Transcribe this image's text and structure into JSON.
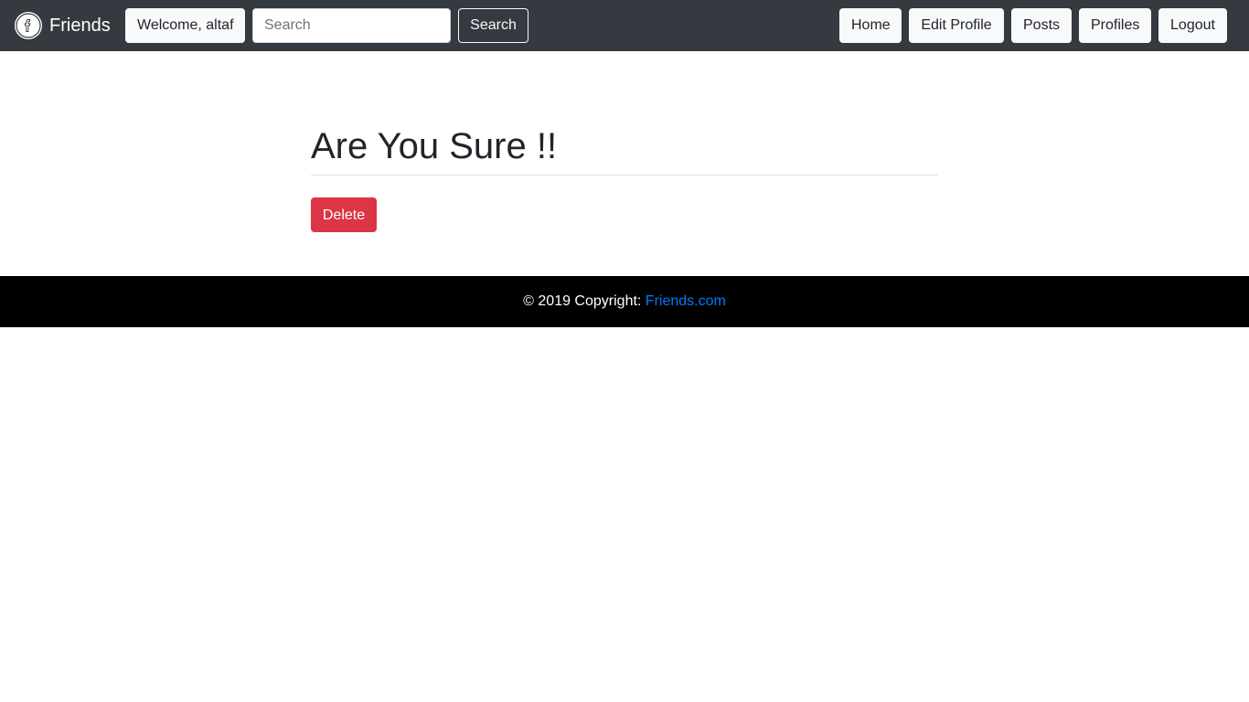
{
  "navbar": {
    "brand_label": "Friends",
    "logo_icon": "facebook-f-icon",
    "welcome_label": "Welcome, altaf",
    "search": {
      "placeholder": "Search",
      "value": "",
      "button_label": "Search"
    },
    "links": [
      {
        "label": "Home"
      },
      {
        "label": "Edit Profile"
      },
      {
        "label": "Posts"
      },
      {
        "label": "Profiles"
      },
      {
        "label": "Logout"
      }
    ],
    "background_color": "#343a40"
  },
  "main": {
    "title": "Are You Sure !!",
    "delete_label": "Delete",
    "delete_color": "#dc3545"
  },
  "footer": {
    "copyright_text": "© 2019 Copyright: ",
    "link_text": "Friends.com",
    "link_color": "#007bff",
    "background_color": "#000000"
  }
}
